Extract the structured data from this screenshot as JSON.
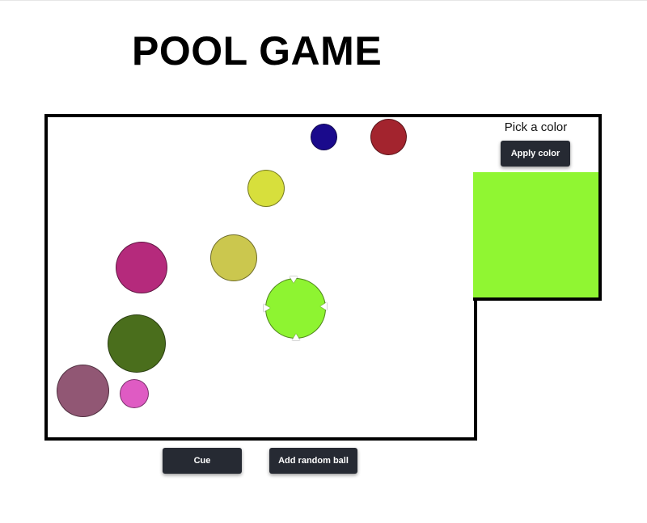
{
  "title": "POOL GAME",
  "picker": {
    "label": "Pick a color",
    "apply_button": "Apply color",
    "selected_color": "#90f632"
  },
  "controls": {
    "cue_button": "Cue",
    "add_ball_button": "Add random ball"
  },
  "balls": [
    {
      "name": "navy-ball",
      "color": "#1a0a8c"
    },
    {
      "name": "red-ball",
      "color": "#a3242e"
    },
    {
      "name": "yellow-ball",
      "color": "#d7df3c"
    },
    {
      "name": "magenta-ball",
      "color": "#b52a7c"
    },
    {
      "name": "olive-yellow-ball",
      "color": "#cbc74e"
    },
    {
      "name": "lime-ball",
      "color": "#8ef431",
      "selected": true
    },
    {
      "name": "dark-green-ball",
      "color": "#4a6e1c"
    },
    {
      "name": "mauve-ball",
      "color": "#915774"
    },
    {
      "name": "pink-ball",
      "color": "#df5bc3"
    }
  ]
}
